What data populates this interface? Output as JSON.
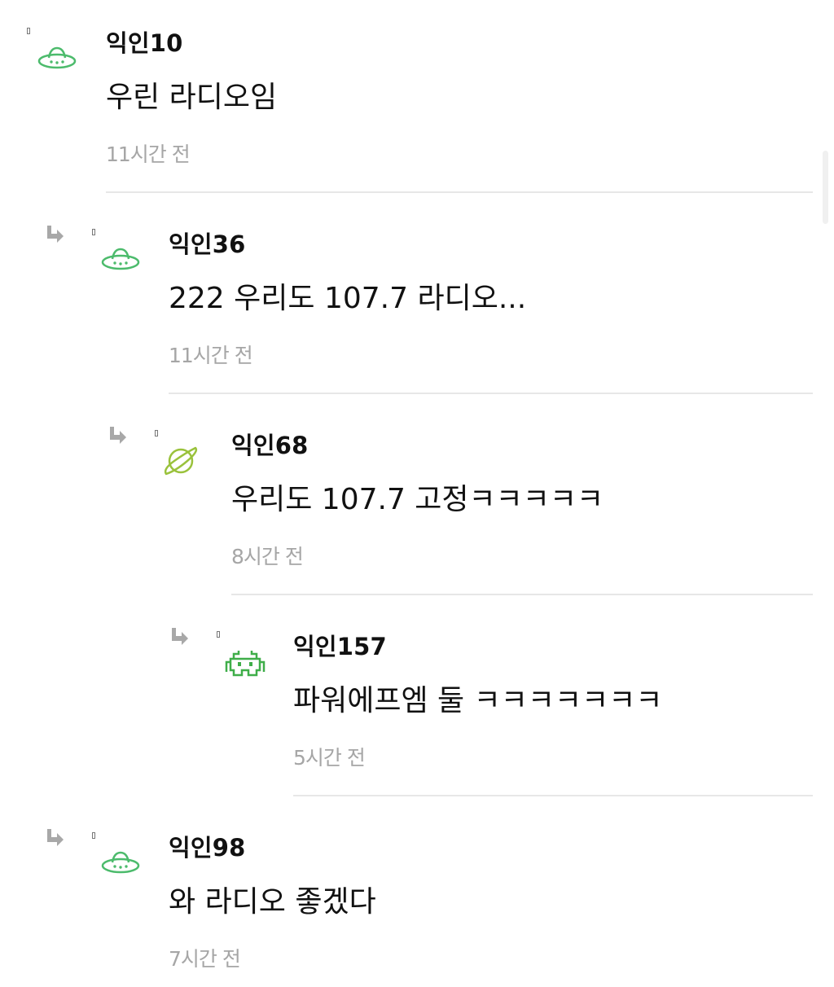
{
  "comments": [
    {
      "author": "익인10",
      "body": "우린 라디오임",
      "time": "11시간 전",
      "avatar": "ufo-icon",
      "reply": false
    },
    {
      "author": "익인36",
      "body": "222 우리도 107.7 라디오...",
      "time": "11시간 전",
      "avatar": "ufo-icon",
      "reply": true
    },
    {
      "author": "익인68",
      "body": "우리도 107.7 고정ㅋㅋㅋㅋㅋ",
      "time": "8시간 전",
      "avatar": "planet-icon",
      "reply": true
    },
    {
      "author": "익인157",
      "body": "파워에프엠 둘 ㅋㅋㅋㅋㅋㅋㅋ",
      "time": "5시간 전",
      "avatar": "space-invader-icon",
      "reply": true
    },
    {
      "author": "익인98",
      "body": "와 라디오 좋겠다",
      "time": "7시간 전",
      "avatar": "ufo-icon",
      "reply": true
    }
  ],
  "colors": {
    "ufo": "#4cbb6c",
    "planet": "#9ac23c",
    "invader": "#3fae49",
    "time": "#a6a6a6",
    "divider": "#e7e7e7",
    "reply_arrow": "#a8a8a8"
  }
}
